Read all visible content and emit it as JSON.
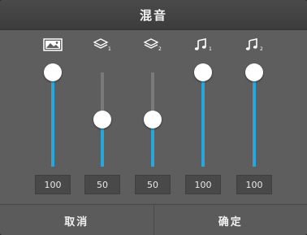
{
  "title": "混音",
  "channels": [
    {
      "icon": "image-icon",
      "sub": "",
      "value": 100,
      "display": "100"
    },
    {
      "icon": "layers-icon",
      "sub": "1",
      "value": 50,
      "display": "50"
    },
    {
      "icon": "layers-icon",
      "sub": "2",
      "value": 50,
      "display": "50"
    },
    {
      "icon": "music-note-icon",
      "sub": "1",
      "value": 100,
      "display": "100"
    },
    {
      "icon": "music-note-icon",
      "sub": "2",
      "value": 100,
      "display": "100"
    }
  ],
  "buttons": {
    "cancel": "取消",
    "confirm": "确定"
  },
  "colors": {
    "accent": "#2aa7da"
  }
}
